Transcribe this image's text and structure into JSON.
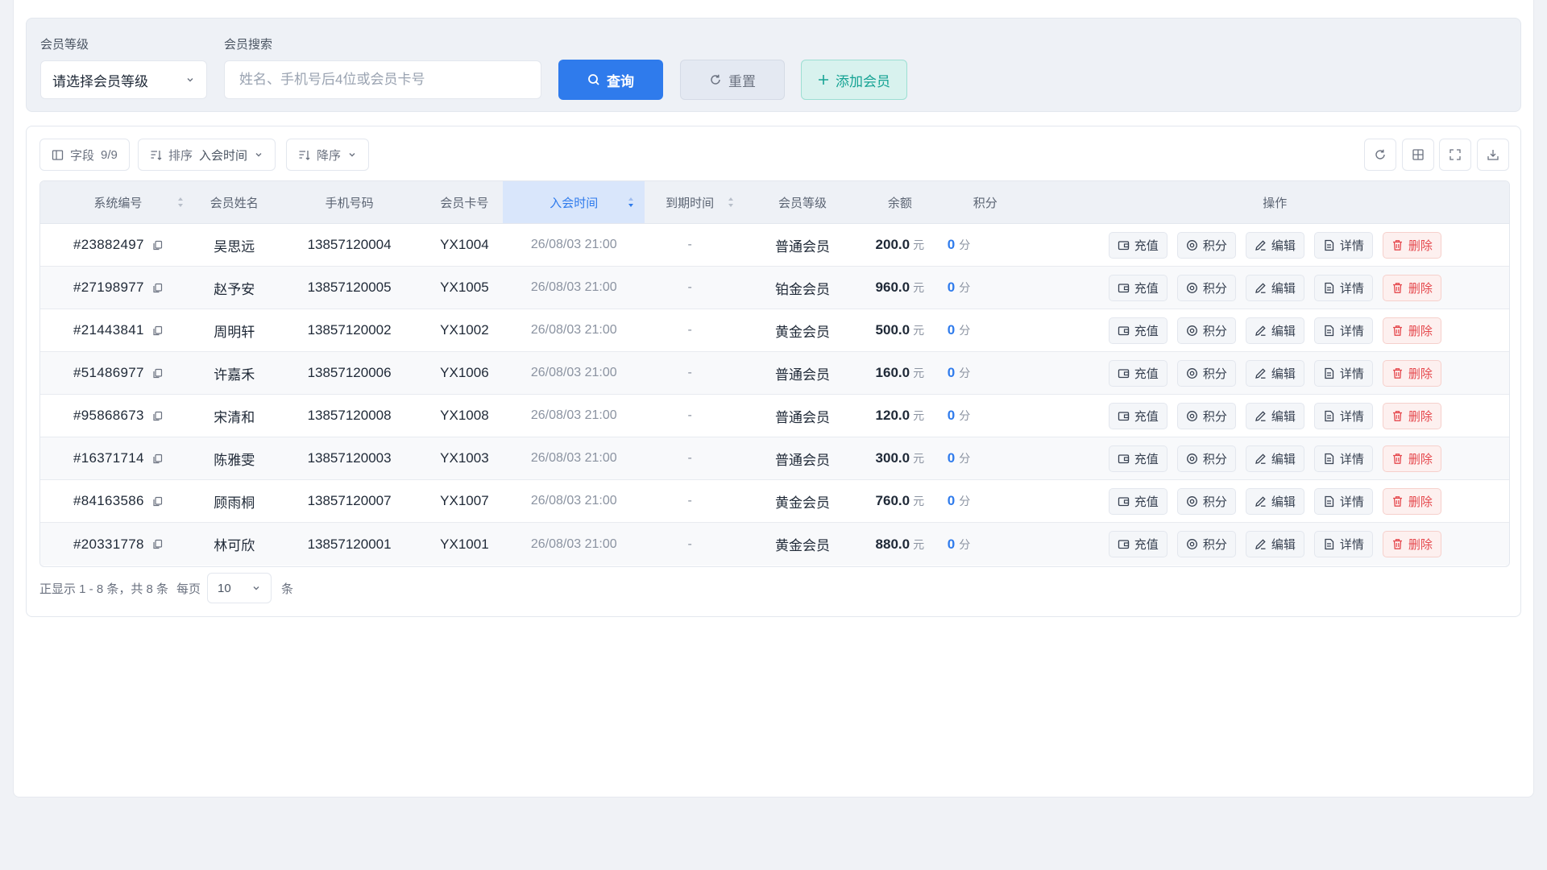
{
  "filter": {
    "level_label": "会员等级",
    "level_placeholder": "请选择会员等级",
    "search_label": "会员搜索",
    "search_placeholder": "姓名、手机号后4位或会员卡号",
    "query_label": "查询",
    "reset_label": "重置",
    "add_label": "添加会员"
  },
  "toolbar": {
    "fields_label": "字段",
    "fields_count": "9/9",
    "sort_label": "排序",
    "sort_value": "入会时间",
    "order_label": "降序"
  },
  "columns": [
    "系统编号",
    "会员姓名",
    "手机号码",
    "会员卡号",
    "入会时间",
    "到期时间",
    "会员等级",
    "余额",
    "积分",
    "操作"
  ],
  "rows": [
    {
      "id": "#23882497",
      "name": "吴思远",
      "phone": "13857120004",
      "card": "YX1004",
      "join": "26/08/03 21:00",
      "expire": "-",
      "level": "普通会员",
      "balance": "200.0",
      "points": "0"
    },
    {
      "id": "#27198977",
      "name": "赵予安",
      "phone": "13857120005",
      "card": "YX1005",
      "join": "26/08/03 21:00",
      "expire": "-",
      "level": "铂金会员",
      "balance": "960.0",
      "points": "0"
    },
    {
      "id": "#21443841",
      "name": "周明轩",
      "phone": "13857120002",
      "card": "YX1002",
      "join": "26/08/03 21:00",
      "expire": "-",
      "level": "黄金会员",
      "balance": "500.0",
      "points": "0"
    },
    {
      "id": "#51486977",
      "name": "许嘉禾",
      "phone": "13857120006",
      "card": "YX1006",
      "join": "26/08/03 21:00",
      "expire": "-",
      "level": "普通会员",
      "balance": "160.0",
      "points": "0"
    },
    {
      "id": "#95868673",
      "name": "宋清和",
      "phone": "13857120008",
      "card": "YX1008",
      "join": "26/08/03 21:00",
      "expire": "-",
      "level": "普通会员",
      "balance": "120.0",
      "points": "0"
    },
    {
      "id": "#16371714",
      "name": "陈雅雯",
      "phone": "13857120003",
      "card": "YX1003",
      "join": "26/08/03 21:00",
      "expire": "-",
      "level": "普通会员",
      "balance": "300.0",
      "points": "0"
    },
    {
      "id": "#84163586",
      "name": "顾雨桐",
      "phone": "13857120007",
      "card": "YX1007",
      "join": "26/08/03 21:00",
      "expire": "-",
      "level": "黄金会员",
      "balance": "760.0",
      "points": "0"
    },
    {
      "id": "#20331778",
      "name": "林可欣",
      "phone": "13857120001",
      "card": "YX1001",
      "join": "26/08/03 21:00",
      "expire": "-",
      "level": "黄金会员",
      "balance": "880.0",
      "points": "0"
    }
  ],
  "units": {
    "currency": "元",
    "points": "分"
  },
  "actions": {
    "recharge": "充值",
    "points": "积分",
    "edit": "编辑",
    "detail": "详情",
    "delete": "删除"
  },
  "pager": {
    "summary": "正显示 1 - 8 条，共 8 条",
    "per_page_label": "每页",
    "per_page_value": "10",
    "unit": "条"
  },
  "colors": {
    "primary": "#2f7bec",
    "teal": "#16a394",
    "danger": "#e5484d"
  },
  "icons": [
    "search-icon",
    "refresh-icon",
    "plus-icon",
    "columns-icon",
    "sort-icon",
    "sort-desc-icon",
    "chevron-down-icon",
    "reload-icon",
    "grid-icon",
    "fullscreen-icon",
    "download-icon",
    "copy-icon",
    "wallet-icon",
    "target-icon",
    "edit-icon",
    "document-icon",
    "trash-icon"
  ]
}
